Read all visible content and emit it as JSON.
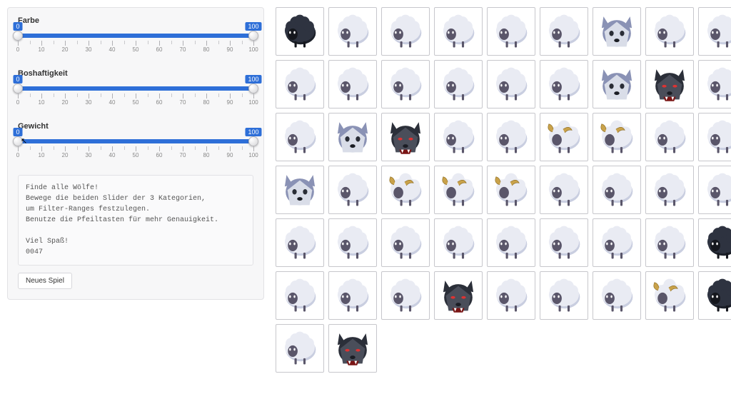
{
  "sliders": [
    {
      "label": "Farbe",
      "min": 0,
      "max": 100,
      "low": 0,
      "high": 100,
      "ticks": [
        0,
        10,
        20,
        30,
        40,
        50,
        60,
        70,
        80,
        90,
        100
      ]
    },
    {
      "label": "Boshaftigkeit",
      "min": 0,
      "max": 100,
      "low": 0,
      "high": 100,
      "ticks": [
        0,
        10,
        20,
        30,
        40,
        50,
        60,
        70,
        80,
        90,
        100
      ]
    },
    {
      "label": "Gewicht",
      "min": 0,
      "max": 100,
      "low": 0,
      "high": 100,
      "ticks": [
        0,
        10,
        20,
        30,
        40,
        50,
        60,
        70,
        80,
        90,
        100
      ]
    }
  ],
  "instructions": {
    "title": "Finde alle Wölfe!",
    "line1": "Bewege die beiden Slider der 3 Kategorien,",
    "line2": "um Filter-Ranges festzulegen.",
    "line3": "Benutze die Pfeiltasten für mehr Genauigkeit.",
    "closing": "Viel Spaß!",
    "code": "0047"
  },
  "new_game_label": "Neues Spiel",
  "colors": {
    "sheep_body": "#e9ebf3",
    "sheep_body_shadow": "#c9cee0",
    "sheep_face": "#5a566a",
    "black_sheep_body": "#2e3340",
    "black_sheep_shadow": "#1c2029",
    "ram_horn": "#c9a24a",
    "wolf_light_fur": "#8a92b5",
    "wolf_light_face": "#d9dde8",
    "wolf_dark_fur": "#2b2f39",
    "wolf_dark_face": "#4a4e5a",
    "wolf_eye": "#d33",
    "wolf_teeth": "#fff"
  },
  "grid": [
    [
      "black_sheep",
      "sheep",
      "sheep",
      "sheep",
      "sheep",
      "sheep",
      "wolf_light",
      "sheep",
      "sheep"
    ],
    [
      "sheep",
      "sheep",
      "sheep",
      "sheep",
      "sheep",
      "sheep",
      "wolf_light",
      "wolf_dark",
      "sheep"
    ],
    [
      "sheep",
      "wolf_light",
      "wolf_dark",
      "sheep",
      "sheep",
      "ram",
      "ram",
      "sheep",
      "sheep"
    ],
    [
      "wolf_light",
      "sheep",
      "ram",
      "ram",
      "ram",
      "sheep",
      "sheep",
      "sheep",
      "sheep"
    ],
    [
      "sheep",
      "sheep",
      "sheep",
      "sheep",
      "sheep",
      "sheep",
      "sheep",
      "sheep",
      "black_sheep"
    ],
    [
      "sheep",
      "sheep",
      "sheep",
      "wolf_dark",
      "sheep",
      "sheep",
      "sheep",
      "ram",
      "black_sheep"
    ],
    [
      "sheep",
      "wolf_dark"
    ]
  ]
}
